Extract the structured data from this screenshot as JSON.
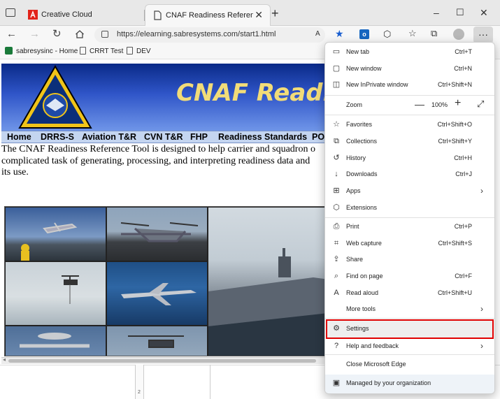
{
  "browser": {
    "tabs": [
      {
        "title": "Creative Cloud",
        "active": false,
        "favicon": "adobe-icon"
      },
      {
        "title": "CNAF Readiness Reference Tool",
        "active": true,
        "favicon": "page-icon"
      }
    ],
    "address": "https://elearning.sabresystems.com/start1.html",
    "favorites": [
      {
        "label": "sabresysinc - Home",
        "icon": "sharepoint-icon"
      },
      {
        "label": "CRRT Test",
        "icon": "page-icon"
      },
      {
        "label": "DEV",
        "icon": "page-icon"
      }
    ],
    "window_controls": {
      "minimize": "–",
      "maximize": "☐",
      "close": "✕"
    }
  },
  "page": {
    "banner_title": "CNAF Readi",
    "nav": [
      "Home",
      "DRRS-S",
      "Aviation T&R",
      "CVN T&R",
      "FHP",
      "Readiness Standards",
      "PO"
    ],
    "intro_lines": [
      "The CNAF Readiness Reference Tool is designed to help carrier and squadron o",
      "complicated task of generating, processing, and interpreting readiness data and",
      "its use."
    ],
    "ruler_number": "2"
  },
  "menu": {
    "items": [
      {
        "label": "New tab",
        "shortcut": "Ctrl+T",
        "icon": "new-tab-icon"
      },
      {
        "label": "New window",
        "shortcut": "Ctrl+N",
        "icon": "new-window-icon"
      },
      {
        "label": "New InPrivate window",
        "shortcut": "Ctrl+Shift+N",
        "icon": "inprivate-icon"
      }
    ],
    "zoom": {
      "label": "Zoom",
      "value": "100%",
      "minus": "—",
      "plus": "+"
    },
    "items2": [
      {
        "label": "Favorites",
        "shortcut": "Ctrl+Shift+O",
        "icon": "favorites-icon"
      },
      {
        "label": "Collections",
        "shortcut": "Ctrl+Shift+Y",
        "icon": "collections-icon"
      },
      {
        "label": "History",
        "shortcut": "Ctrl+H",
        "icon": "history-icon"
      },
      {
        "label": "Downloads",
        "shortcut": "Ctrl+J",
        "icon": "download-icon"
      },
      {
        "label": "Apps",
        "shortcut": "",
        "icon": "apps-icon",
        "submenu": true
      },
      {
        "label": "Extensions",
        "shortcut": "",
        "icon": "extensions-icon"
      }
    ],
    "items3": [
      {
        "label": "Print",
        "shortcut": "Ctrl+P",
        "icon": "print-icon"
      },
      {
        "label": "Web capture",
        "shortcut": "Ctrl+Shift+S",
        "icon": "web-capture-icon"
      },
      {
        "label": "Share",
        "shortcut": "",
        "icon": "share-icon"
      },
      {
        "label": "Find on page",
        "shortcut": "Ctrl+F",
        "icon": "find-icon"
      },
      {
        "label": "Read aloud",
        "shortcut": "Ctrl+Shift+U",
        "icon": "read-aloud-icon"
      },
      {
        "label": "More tools",
        "shortcut": "",
        "icon": "",
        "submenu": true
      }
    ],
    "settings": {
      "label": "Settings",
      "icon": "gear-icon",
      "highlight_color": "#e00000"
    },
    "help": {
      "label": "Help and feedback",
      "icon": "help-icon"
    },
    "close_edge": "Close Microsoft Edge",
    "managed": "Managed by your organization"
  }
}
